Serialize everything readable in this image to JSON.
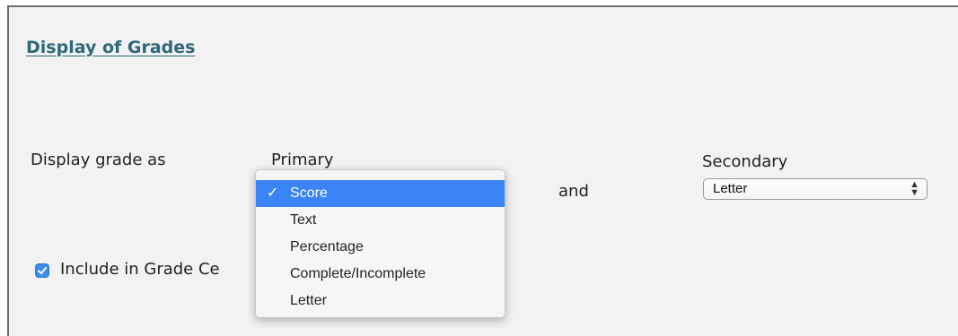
{
  "section": {
    "title": "Display of Grades"
  },
  "display_grade": {
    "label": "Display grade as",
    "primary_label": "Primary",
    "and_label": "and",
    "secondary_label": "Secondary",
    "secondary_value": "Letter"
  },
  "primary_dropdown": {
    "selected": "Score",
    "options": [
      "Score",
      "Text",
      "Percentage",
      "Complete/Incomplete",
      "Letter"
    ]
  },
  "include_checkbox": {
    "label": "Include in Grade Ce",
    "checked": true
  },
  "colors": {
    "title": "#2f6878",
    "accent": "#3a84f5",
    "checkbox": "#3b8de8"
  }
}
